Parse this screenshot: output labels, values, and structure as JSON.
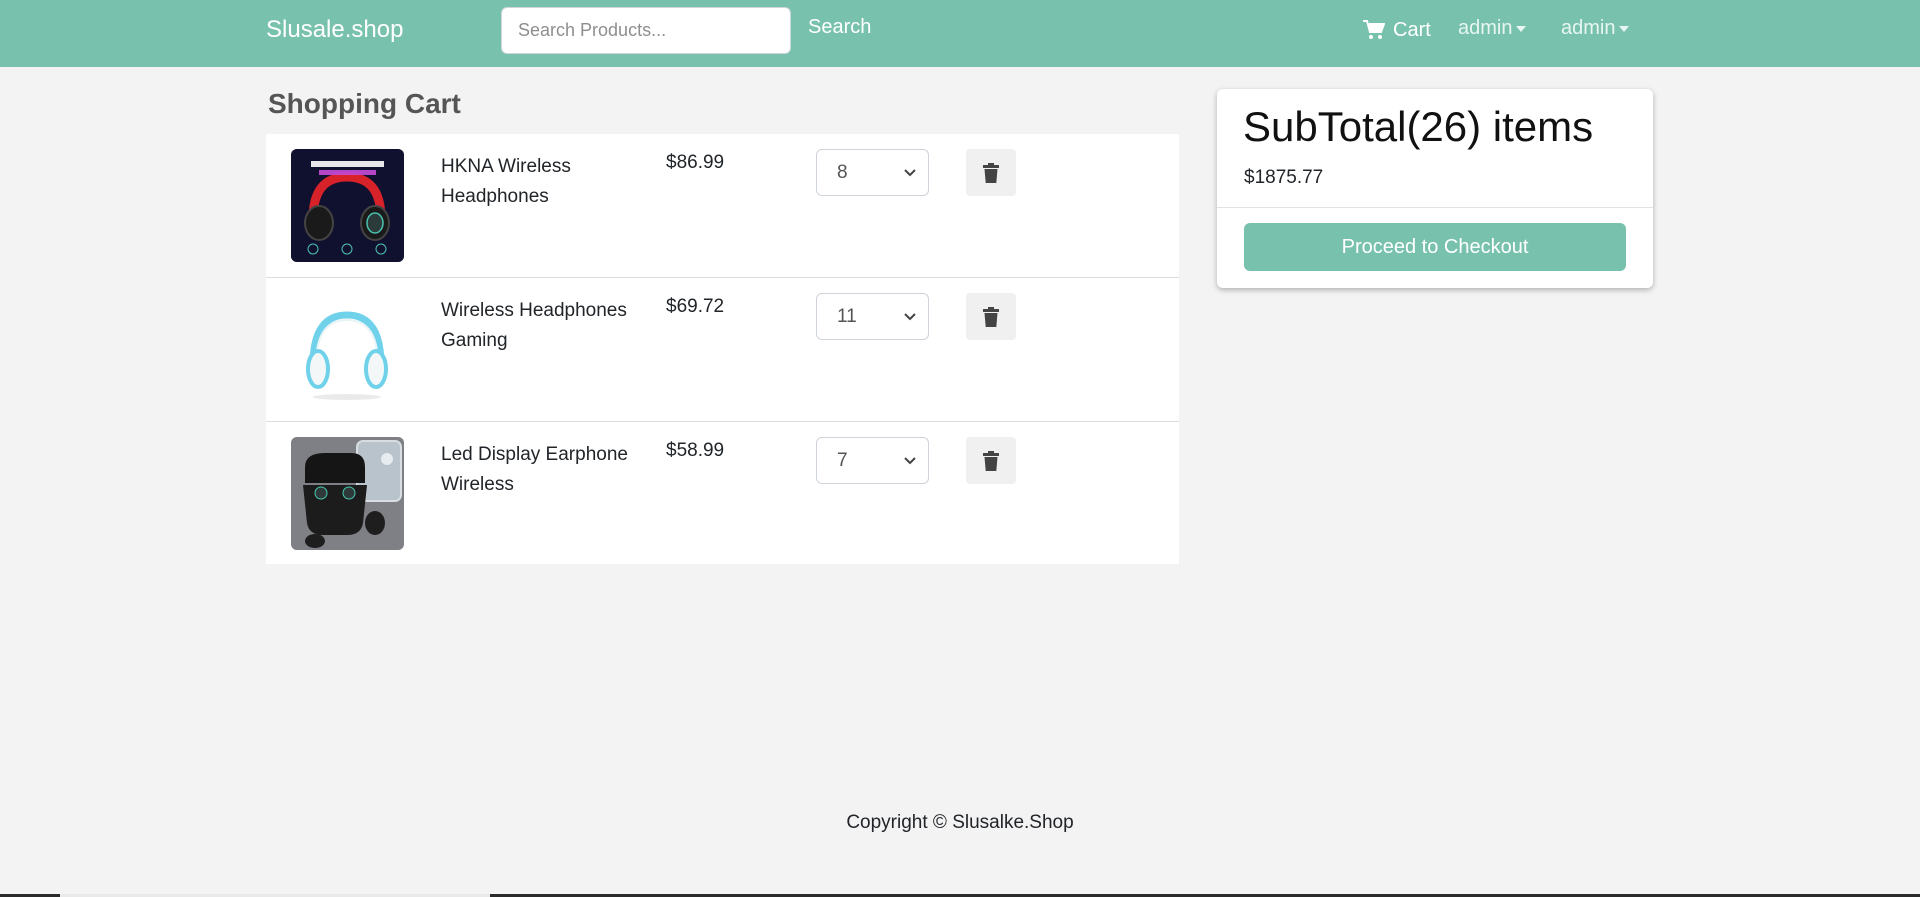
{
  "nav": {
    "brand": "Slusale.shop",
    "search_placeholder": "Search Products...",
    "search_label": "Search",
    "cart_label": "Cart",
    "user_menus": [
      "admin",
      "admin"
    ]
  },
  "cart": {
    "title": "Shopping Cart",
    "items": [
      {
        "name": "HKNA Wireless Headphones",
        "price": "$86.99",
        "qty": "8"
      },
      {
        "name": "Wireless Headphones Gaming",
        "price": "$69.72",
        "qty": "11"
      },
      {
        "name": "Led Display Earphone Wireless",
        "price": "$58.99",
        "qty": "7"
      }
    ]
  },
  "summary": {
    "title": "SubTotal(26) items",
    "price": "$1875.77",
    "checkout_label": "Proceed to Checkout"
  },
  "footer": {
    "text": "Copyright © Slusalke.Shop"
  },
  "colors": {
    "accent": "#78c2ad",
    "background": "#f3f3f3"
  }
}
